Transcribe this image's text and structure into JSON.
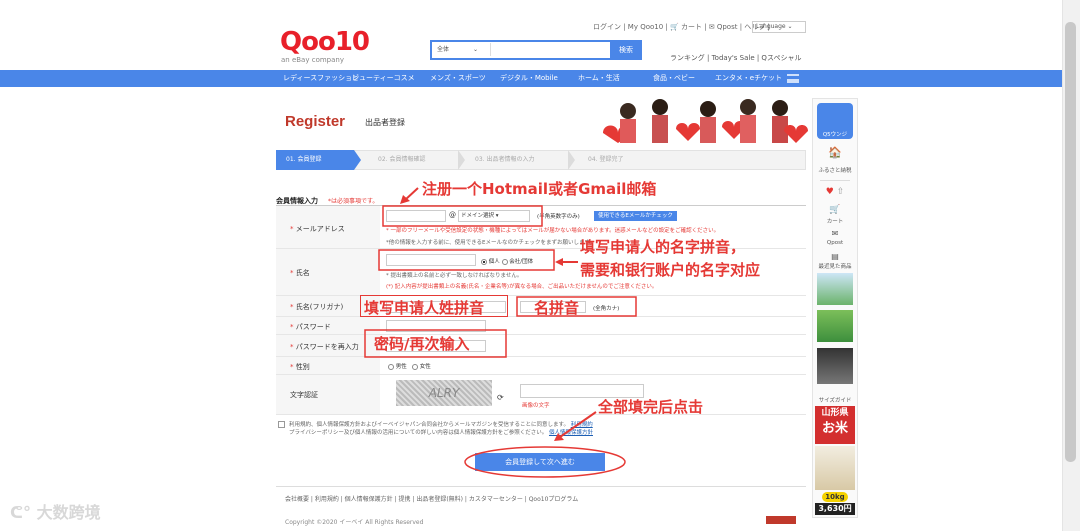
{
  "header": {
    "logo": "Qoo10",
    "logo_sub": "an eBay company",
    "search_select": "全体",
    "search_button": "検索",
    "top_links": "ログイン | My Qoo10 | 🛒 カート | ✉ Qpost | ヘルプ |",
    "language": "Language",
    "sub_links": "ランキング | Today's Sale | Qスペシャル"
  },
  "nav": {
    "items": [
      "レディースファッション",
      "ビューティーコスメ",
      "メンズ・スポーツ",
      "デジタル・Mobile",
      "ホーム・生活",
      "食品・ベビー",
      "エンタメ・eチケット"
    ]
  },
  "page": {
    "register_title": "Register",
    "register_sub": "出品者登録"
  },
  "steps": [
    "01. 会員登録",
    "02. 会員情報確認",
    "03. 出品者情報の入力",
    "04. 登録完了"
  ],
  "form": {
    "head": "会員情報入力",
    "req_note": "*は必須事項です。",
    "email_label": "メールアドレス",
    "email_domain": "ドメイン選択",
    "email_halfwidth": "(半角英数字のみ)",
    "email_check_btn": "使用できるEメールかチェック",
    "email_red_note": "* 一部のフリーメールや受信設定の状態・機種によってはメールが届かない場合があります。迷惑メールなどの設定をご確認ください。",
    "email_grey_note": "*他の情報を入力する前に、使用できるEメールなのかチェックをまずお願いします。",
    "name_label": "氏名",
    "name_personal": "個人",
    "name_company": "会社/団体",
    "name_grey_note": "* 提出書類上の名前と必ず一致しなければなりません。",
    "name_red_note": "(*) 記入内容が提出書類上の名義(氏名・企業名等)が異なる場合、ご出品いただけませんのでご注意ください。",
    "kana_label": "氏名(フリガナ)",
    "kana_suffix": "(全角カナ)",
    "password_label": "パスワード",
    "password_confirm_label": "パスワードを再入力",
    "gender_label": "性別",
    "gender_male": "男性",
    "gender_female": "女性",
    "captcha_label": "文字認証",
    "captcha_text": "ALRY",
    "captcha_hint": "画像の文字",
    "agree_text_1": "利用規約、個人情報保護方針およびイーベイジャパン合同会社からメールマガジンを受信することに同意します。",
    "agree_link_1": "利用規約",
    "agree_text_2": "プライバシーポリシー及び個人情報の活用についての詳しい内容は個人情報保護方針をご参照ください。",
    "agree_link_2": "個人情報保護方針",
    "submit": "会員登録して次へ進む"
  },
  "annotations": {
    "email_note": "注册一个Hotmail或者Gmail邮箱",
    "name_note_1": "填写申请人的名字拼音，",
    "name_note_2": "需要和银行账户的名字对应",
    "surname_note": "填写申请人姓拼音",
    "givenname_note": "名拼音",
    "password_note": "密码/再次输入",
    "submit_note": "全部填完后点击"
  },
  "footer": {
    "links": "会社概要 | 利用規約 | 個人情報保護方針 | 提携 | 出品者登録(無料) | カスタマーセンター | Qoo10プログラム",
    "copyright": "Copyright ©2020 イーベイ All Rights Reserved"
  },
  "rail": {
    "items": [
      "Q5ウンジ",
      "ふるさと納税",
      "カート",
      "Qpost",
      "最近見た商品",
      "サイズガイド",
      "山形県",
      "お米",
      "10kg",
      "3,630円"
    ]
  },
  "watermark": "大数跨境"
}
